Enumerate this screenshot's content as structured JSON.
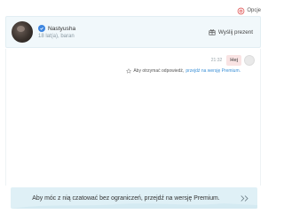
{
  "topbar": {
    "options_label": "Opcje",
    "options_icon": "gear-icon"
  },
  "profile": {
    "name": "Nastyusha",
    "meta": "18 lat(a), baran",
    "verified_icon": "verified-badge-icon",
    "gift_label": "Wyślij prezent",
    "gift_icon": "gift-icon"
  },
  "chat": {
    "message": {
      "time": "21:32",
      "text": "Hej"
    },
    "hint": {
      "text": "Aby otrzymać odpowiedź,",
      "link": "przejdź na wersję Premium.",
      "icon": "star-icon"
    }
  },
  "banner": {
    "text": "Aby móc z nią czatować bez ograniczeń, przejdź na wersję Premium.",
    "icon": "double-chevron-right-icon"
  },
  "colors": {
    "accent": "#3e86e0",
    "link": "#3a8fd6",
    "bubble": "#f9e3e3",
    "banner": "#dff0f6",
    "options": "#e05a5a"
  }
}
